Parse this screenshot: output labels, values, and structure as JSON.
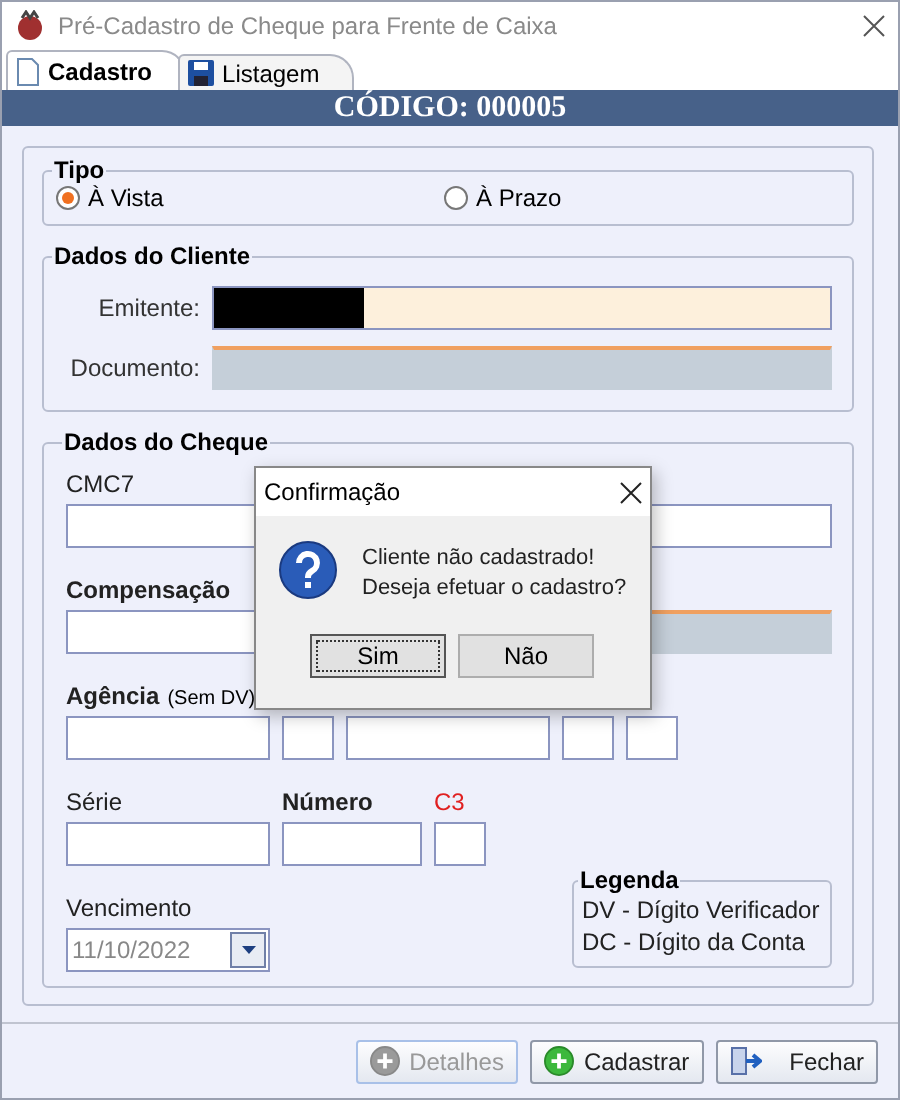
{
  "window": {
    "title": "Pré-Cadastro de Cheque para Frente de Caixa"
  },
  "tabs": [
    {
      "label": "Cadastro",
      "selected": true,
      "kind": "page"
    },
    {
      "label": "Listagem",
      "selected": false,
      "kind": "disk"
    }
  ],
  "header": "CÓDIGO: 000005",
  "tipo": {
    "title": "Tipo",
    "options": [
      {
        "label": "À Vista",
        "selected": true
      },
      {
        "label": "À Prazo",
        "selected": false
      }
    ]
  },
  "cliente": {
    "title": "Dados do Cliente",
    "fields": [
      {
        "label": "Emitente:",
        "redacted": true,
        "disabled": false
      },
      {
        "label": "Documento:",
        "redacted": false,
        "disabled": true
      }
    ]
  },
  "cheque": {
    "title": "Dados do Cheque",
    "cmc7_label": "CMC7",
    "compensacao_label": "Compensação",
    "agencia_label": "Agência",
    "agencia_hint": "(Sem DV)",
    "serie_label": "Série",
    "numero_label": "Número",
    "c3_label": "C3",
    "vencimento_label": "Vencimento",
    "vencimento_value": "11/10/2022"
  },
  "legenda": {
    "title": "Legenda",
    "lines": [
      "DV - Dígito Verificador",
      "DC - Dígito da Conta"
    ]
  },
  "buttons": [
    {
      "label": "Detalhes",
      "kind": "plus",
      "disabled": true
    },
    {
      "label": "Cadastrar",
      "kind": "plus",
      "disabled": false
    },
    {
      "label": "Fechar",
      "kind": "exit",
      "disabled": false
    }
  ],
  "dialog": {
    "title": "Confirmação",
    "message": "Cliente não cadastrado!\nDeseja efetuar o cadastro?",
    "buttons": [
      {
        "label": "Sim",
        "selected": true
      },
      {
        "label": "Não",
        "selected": false
      }
    ]
  }
}
